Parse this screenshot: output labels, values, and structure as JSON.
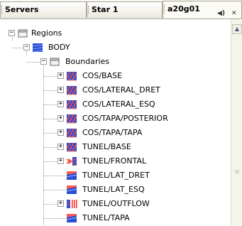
{
  "tabs": [
    {
      "label": "Servers"
    },
    {
      "label": "Star 1"
    },
    {
      "label": "a20g01"
    }
  ],
  "tab_controls": {
    "sound": "◀)",
    "close": "✕"
  },
  "tree": {
    "root": {
      "label": "Regions",
      "expander": "−"
    },
    "body": {
      "label": "BODY",
      "expander": "−"
    },
    "boundaries": {
      "label": "Boundaries",
      "expander": "−"
    },
    "items": [
      {
        "label": "COS/BASE",
        "expander": "+",
        "icon": "surface-wall-icon"
      },
      {
        "label": "COS/LATERAL_DRET",
        "expander": "+",
        "icon": "surface-wall-icon"
      },
      {
        "label": "COS/LATERAL_ESQ",
        "expander": "+",
        "icon": "surface-wall-icon"
      },
      {
        "label": "COS/TAPA/POSTERIOR",
        "expander": "+",
        "icon": "surface-wall-icon"
      },
      {
        "label": "COS/TAPA/TAPA",
        "expander": "+",
        "icon": "surface-wall-icon"
      },
      {
        "label": "TUNEL/BASE",
        "expander": "+",
        "icon": "surface-wall-icon"
      },
      {
        "label": "TUNEL/FRONTAL",
        "expander": "+",
        "icon": "inlet-arrow-icon"
      },
      {
        "label": "TUNEL/LAT_DRET",
        "expander": "",
        "icon": "symmetry-plane-icon"
      },
      {
        "label": "TUNEL/LAT_ESQ",
        "expander": "",
        "icon": "symmetry-plane-icon"
      },
      {
        "label": "TUNEL/OUTFLOW",
        "expander": "+",
        "icon": "outlet-bars-icon"
      },
      {
        "label": "TUNEL/TAPA",
        "expander": "",
        "icon": "symmetry-plane-icon"
      }
    ]
  },
  "scrollbar": {
    "up_arrow": "▲"
  }
}
